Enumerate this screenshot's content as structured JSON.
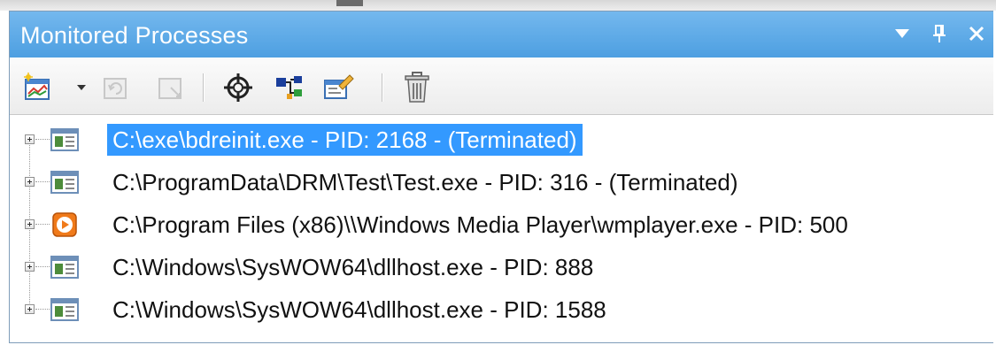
{
  "window": {
    "title": "Monitored Processes"
  },
  "title_buttons": [
    {
      "name": "dropdown-arrow-icon",
      "glyph": "▼"
    },
    {
      "name": "pin-icon",
      "glyph": "pin"
    },
    {
      "name": "close-icon",
      "glyph": "✕"
    }
  ],
  "toolbar": {
    "tools": [
      {
        "name": "monitor-new-process-icon",
        "enabled": true
      },
      {
        "name": "dropdown-chevron-icon",
        "enabled": true
      },
      {
        "name": "refresh-icon",
        "enabled": false
      },
      {
        "name": "stop-monitor-icon",
        "enabled": false
      },
      {
        "name": "target-crosshair-icon",
        "enabled": true
      },
      {
        "name": "process-tree-icon",
        "enabled": true
      },
      {
        "name": "properties-icon",
        "enabled": true
      },
      {
        "name": "trash-icon",
        "enabled": true
      }
    ]
  },
  "processes": [
    {
      "label": "C:\\exe\\bdreinit.exe - PID: 2168 - (Terminated)",
      "icon": "window-app-icon",
      "selected": true
    },
    {
      "label": "C:\\ProgramData\\DRM\\Test\\Test.exe - PID: 316 - (Terminated)",
      "icon": "window-app-icon",
      "selected": false
    },
    {
      "label": "C:\\Program Files (x86)\\\\Windows Media Player\\wmplayer.exe - PID: 500",
      "icon": "media-player-icon",
      "selected": false
    },
    {
      "label": "C:\\Windows\\SysWOW64\\dllhost.exe - PID: 888",
      "icon": "window-app-icon",
      "selected": false
    },
    {
      "label": "C:\\Windows\\SysWOW64\\dllhost.exe - PID: 1588",
      "icon": "window-app-icon",
      "selected": false
    }
  ],
  "colors": {
    "titlebar": "#5aa8e6",
    "selection": "#3399ff",
    "media_player_orange": "#f07a1a"
  }
}
